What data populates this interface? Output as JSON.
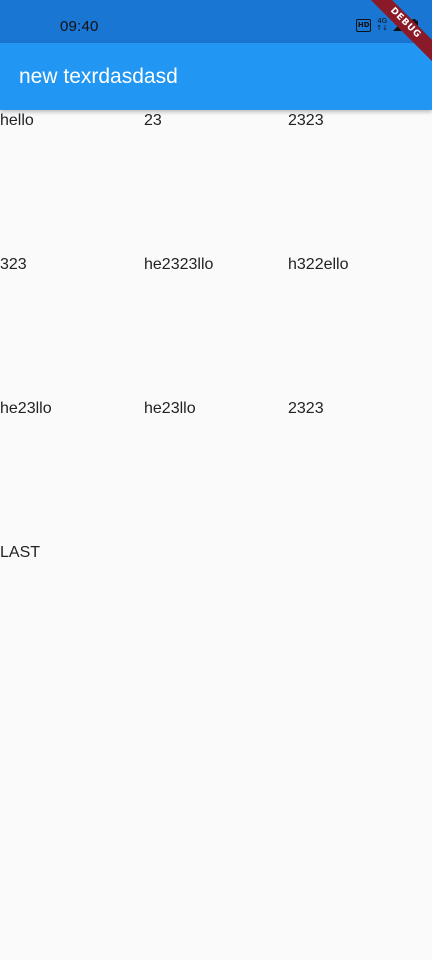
{
  "status_bar": {
    "time": "09:40",
    "hd_label": "HD",
    "network_label": "4G"
  },
  "app_bar": {
    "title": "new texrdasdasd"
  },
  "grid": {
    "rows": [
      [
        "hello",
        "23",
        "2323"
      ],
      [
        "323",
        "he2323llo",
        "h322ello"
      ],
      [
        "he23llo",
        "he23llo",
        "2323"
      ],
      [
        "LAST",
        "",
        ""
      ]
    ]
  },
  "debug_banner": {
    "label": "DEBUG"
  },
  "colors": {
    "status_bar": "#1976d2",
    "app_bar": "#2196f3",
    "background": "#fafafa",
    "debug_ribbon": "#8b1a28"
  }
}
